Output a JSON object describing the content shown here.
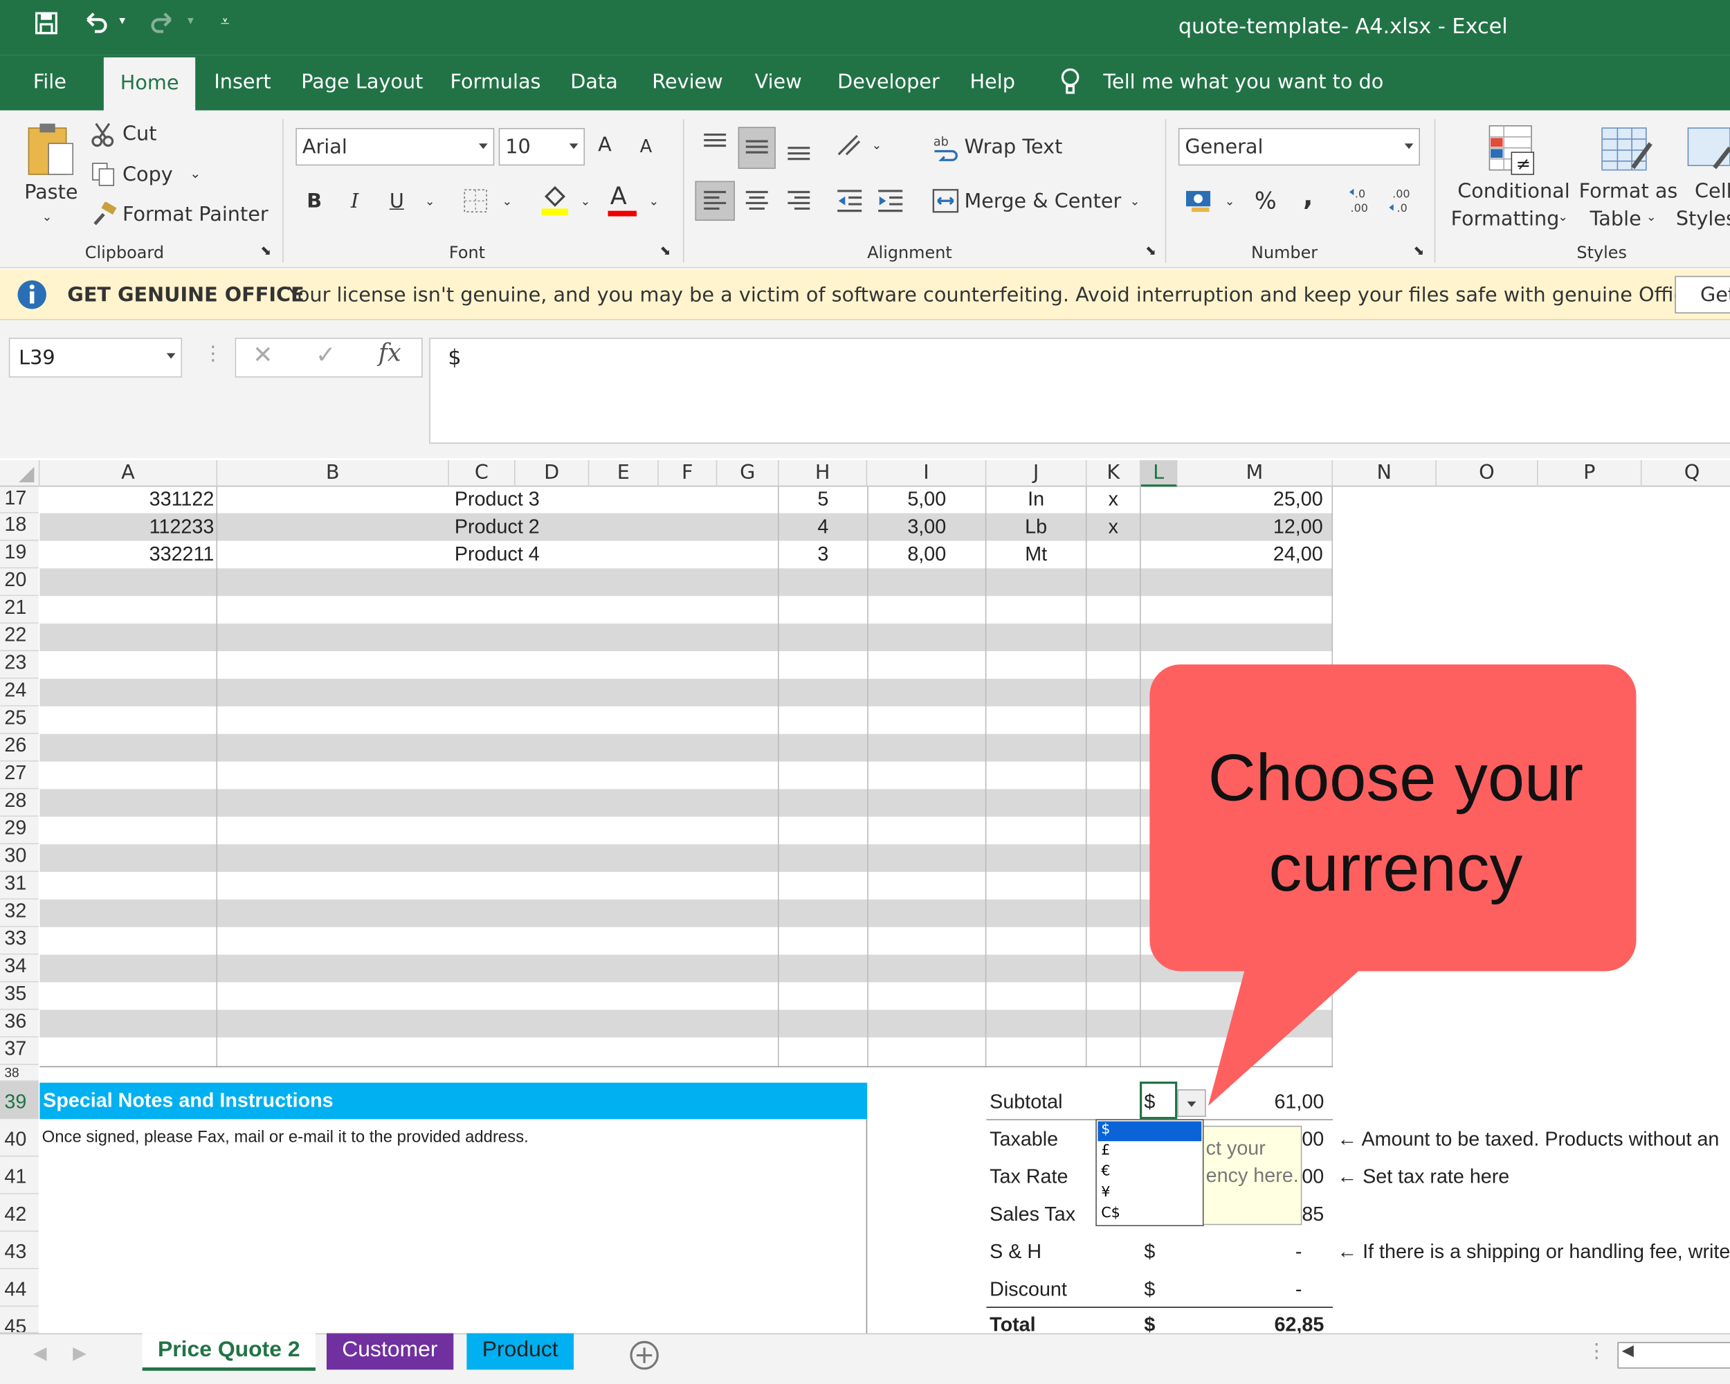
{
  "window": {
    "title": "quote-template- A4.xlsx  -  Excel"
  },
  "tabs": [
    "File",
    "Home",
    "Insert",
    "Page Layout",
    "Formulas",
    "Data",
    "Review",
    "View",
    "Developer",
    "Help"
  ],
  "tell_me": "Tell me what you want to do",
  "ribbon": {
    "clipboard": {
      "paste": "Paste",
      "cut": "Cut",
      "copy": "Copy",
      "format_painter": "Format Painter",
      "label": "Clipboard"
    },
    "font": {
      "name": "Arial",
      "size": "10",
      "bold": "B",
      "italic": "I",
      "underline": "U",
      "grow": "A",
      "shrink": "A",
      "font_color": "A",
      "label": "Font"
    },
    "alignment": {
      "wrap": "Wrap Text",
      "merge": "Merge & Center",
      "label": "Alignment"
    },
    "number": {
      "format": "General",
      "percent": "%",
      "comma": ",",
      "label": "Number"
    },
    "styles": {
      "conditional_1": "Conditional",
      "conditional_2": "Formatting",
      "format_table_1": "Format as",
      "format_table_2": "Table",
      "cell_styles_1": "Cell",
      "cell_styles_2": "Styles",
      "label": "Styles"
    }
  },
  "notification": {
    "title": "GET GENUINE OFFICE",
    "message": "Your license isn't genuine, and you may be a victim of software counterfeiting. Avoid interruption and keep your files safe with genuine Office today.",
    "button": "Get"
  },
  "formula_bar": {
    "name_box": "L39",
    "fx": "fx",
    "content": "$"
  },
  "columns": [
    "A",
    "B",
    "C",
    "D",
    "E",
    "F",
    "G",
    "H",
    "I",
    "J",
    "K",
    "L",
    "M",
    "N",
    "O",
    "P",
    "Q"
  ],
  "rows": [
    "17",
    "18",
    "19",
    "20",
    "21",
    "22",
    "23",
    "24",
    "25",
    "26",
    "27",
    "28",
    "29",
    "30",
    "31",
    "32",
    "33",
    "34",
    "35",
    "36",
    "37",
    "38",
    "39",
    "40",
    "41",
    "42",
    "43",
    "44",
    "45"
  ],
  "items": [
    {
      "code": "331122",
      "product": "Product 3",
      "qty": "5",
      "price": "5,00",
      "unit": "In",
      "taxed": "x",
      "total": "25,00"
    },
    {
      "code": "112233",
      "product": "Product 2",
      "qty": "4",
      "price": "3,00",
      "unit": "Lb",
      "taxed": "x",
      "total": "12,00"
    },
    {
      "code": "332211",
      "product": "Product 4",
      "qty": "3",
      "price": "8,00",
      "unit": "Mt",
      "taxed": "",
      "total": "24,00"
    }
  ],
  "notes": {
    "header": "Special Notes and Instructions",
    "text": "Once signed, please Fax, mail or e-mail it to the provided address."
  },
  "totals": {
    "subtotal": {
      "label": "Subtotal",
      "cur": "$",
      "value": "61,00"
    },
    "taxable": {
      "label": "Taxable",
      "value": "00"
    },
    "tax_rate": {
      "label": "Tax Rate",
      "value": "00"
    },
    "sales_tax": {
      "label": "Sales Tax",
      "value": "85"
    },
    "sh": {
      "label": "S & H",
      "cur": "$",
      "value": "-"
    },
    "discount": {
      "label": "Discount",
      "cur": "$",
      "value": "-"
    },
    "total": {
      "label": "Total",
      "cur": "$",
      "value": "62,85"
    }
  },
  "annotations": {
    "taxable": "← Amount to be taxed. Products without an",
    "tax_rate": "← Set tax rate here",
    "sh": "← If there is a shipping or handling fee, write"
  },
  "currency_dropdown": {
    "options": [
      "$",
      "£",
      "€",
      "¥",
      "C$"
    ],
    "selected": "$"
  },
  "tooltip": {
    "line1": "ct your",
    "line2": "ency here."
  },
  "callout": {
    "line1": "Choose your",
    "line2": "currency"
  },
  "sheets": [
    "Price Quote 2",
    "Customer",
    "Product"
  ],
  "colors": {
    "excel_green": "#217346",
    "callout": "#fe6060",
    "notes_header": "#00b0f0",
    "customer_tab": "#7030a0",
    "product_tab": "#00b0f0"
  }
}
